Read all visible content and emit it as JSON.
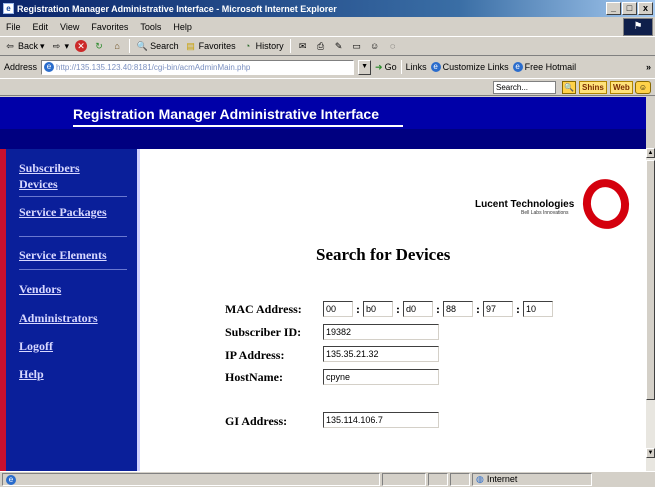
{
  "window": {
    "title": "Registration Manager Administrative Interface - Microsoft Internet Explorer",
    "app_icon": "e",
    "min": "_",
    "max": "□",
    "close": "x"
  },
  "menu": [
    "File",
    "Edit",
    "View",
    "Favorites",
    "Tools",
    "Help"
  ],
  "toolbar": {
    "back": "Back",
    "search": "Search",
    "favorites": "Favorites",
    "history": "History"
  },
  "address": {
    "label": "Address",
    "url": "http://135.135.123.40:8181/cgi-bin/acmAdminMain.php",
    "go": "Go",
    "links": "Links",
    "customize": "Customize Links",
    "hotmail": "Free Hotmail",
    "chevron": "»"
  },
  "searchbar": {
    "placeholder": "Search...",
    "shins": "Shins",
    "web": "Web"
  },
  "page": {
    "banner_title": "Registration Manager Administrative Interface",
    "logo_name": "Lucent Technologies",
    "logo_tagline": "Bell Labs Innovations",
    "heading": "Search for Devices"
  },
  "nav": [
    {
      "label": "Subscribers"
    },
    {
      "label": "Devices"
    },
    {
      "label": "Service Packages"
    },
    {
      "label": "Service Elements"
    },
    {
      "label": "Vendors"
    },
    {
      "label": "Administrators"
    },
    {
      "label": "Logoff"
    },
    {
      "label": "Help"
    }
  ],
  "form": {
    "mac_label": "MAC Address:",
    "mac": [
      "00",
      "b0",
      "d0",
      "88",
      "97",
      "10"
    ],
    "subscriber_label": "Subscriber ID:",
    "subscriber": "19382",
    "ip_label": "IP Address:",
    "ip": "135.35.21.32",
    "host_label": "HostName:",
    "host": "cpyne",
    "gi_label": "GI Address:",
    "gi": "135.114.106.7"
  },
  "status": {
    "zone": "Internet"
  }
}
